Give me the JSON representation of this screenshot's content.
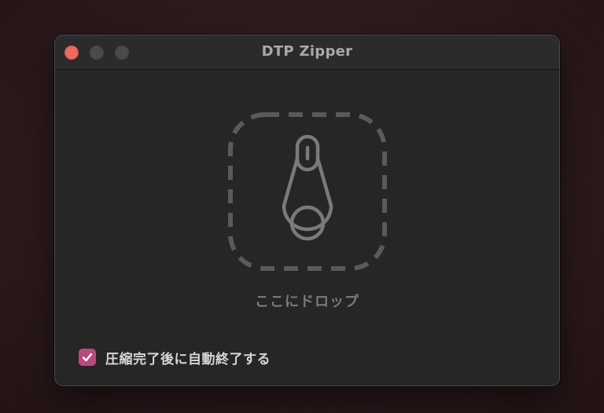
{
  "window": {
    "title": "DTP Zipper"
  },
  "dropzone": {
    "label": "ここにドロップ",
    "icon": "zipper-pull-icon"
  },
  "options": {
    "auto_quit_label": "圧縮完了後に自動終了する",
    "auto_quit_checked": true
  },
  "colors": {
    "close": "#ed6a5e",
    "accent": "#b94a7e"
  }
}
